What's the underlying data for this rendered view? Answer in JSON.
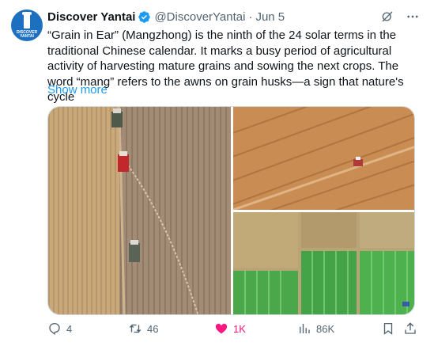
{
  "author": {
    "name": "Discover Yantai",
    "handle": "@DiscoverYantai",
    "date": "Jun 5",
    "avatar_text": "DISCOVER YANTAI",
    "verified_color": "#1d9bf0"
  },
  "body": {
    "text": "“Grain in Ear” (Mangzhong) is the ninth of the 24 solar terms in the traditional Chinese calendar. It marks a busy period of agricultural activity of harvesting mature grains and sowing the next crops. The word “mang” refers to the awns on grain husks—a sign that nature's cycle",
    "show_more": "Show more"
  },
  "top_icons": [
    "grok-icon",
    "more-icon"
  ],
  "media": {
    "images": [
      {
        "name": "harvest-field-combines",
        "icon": "photo"
      },
      {
        "name": "plowed-field-tractor",
        "icon": "photo"
      },
      {
        "name": "green-and-golden-fields",
        "icon": "photo"
      }
    ]
  },
  "actions": {
    "replies": "4",
    "reposts": "46",
    "likes": "1K",
    "views": "86K",
    "like_color": "#f91880"
  },
  "colors": {
    "text": "#0f1419",
    "secondary": "#536471",
    "link": "#1d9bf0"
  }
}
